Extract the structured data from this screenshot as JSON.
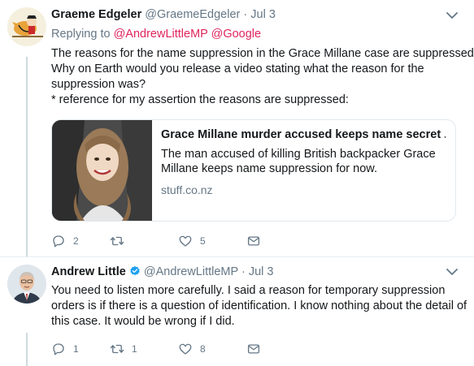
{
  "tweets": [
    {
      "name": "Graeme Edgeler",
      "handle": "@GraemeEdgeler",
      "date": "Jul 3",
      "replying_prefix": "Replying to",
      "mentions": [
        "@AndrewLittleMP",
        "@Google"
      ],
      "text_lines": [
        "The reasons for the name suppression in the Grace Millane case are suppressed.*",
        "Why on Earth would you release a video stating what the reason for the",
        "suppression was?",
        "* reference for my assertion the reasons are suppressed:"
      ],
      "card": {
        "title": "Grace Millane murder accused keeps name secret ...",
        "description_lines": [
          "The man accused of killing British backpacker Grace",
          "Millane keeps name suppression for now."
        ],
        "domain": "stuff.co.nz"
      },
      "actions": {
        "replies": "2",
        "retweets": "",
        "likes": "5"
      }
    },
    {
      "name": "Andrew Little",
      "handle": "@AndrewLittleMP",
      "date": "Jul 3",
      "verified": true,
      "text_lines": [
        "You need to listen more carefully. I said a reason for temporary suppression",
        "orders is if there is a question of identification. I know nothing about the detail of",
        "this case. It would be wrong if I did."
      ],
      "actions": {
        "replies": "1",
        "retweets": "1",
        "likes": "8"
      }
    }
  ],
  "colors": {
    "mention": "#e0245e",
    "secondary_text": "#657786",
    "verified": "#1da1f2",
    "icon": "#657786"
  },
  "icons": [
    "avatar",
    "chevron-down-icon",
    "verified-badge-icon",
    "reply-icon",
    "retweet-icon",
    "like-icon",
    "direct-message-icon"
  ]
}
